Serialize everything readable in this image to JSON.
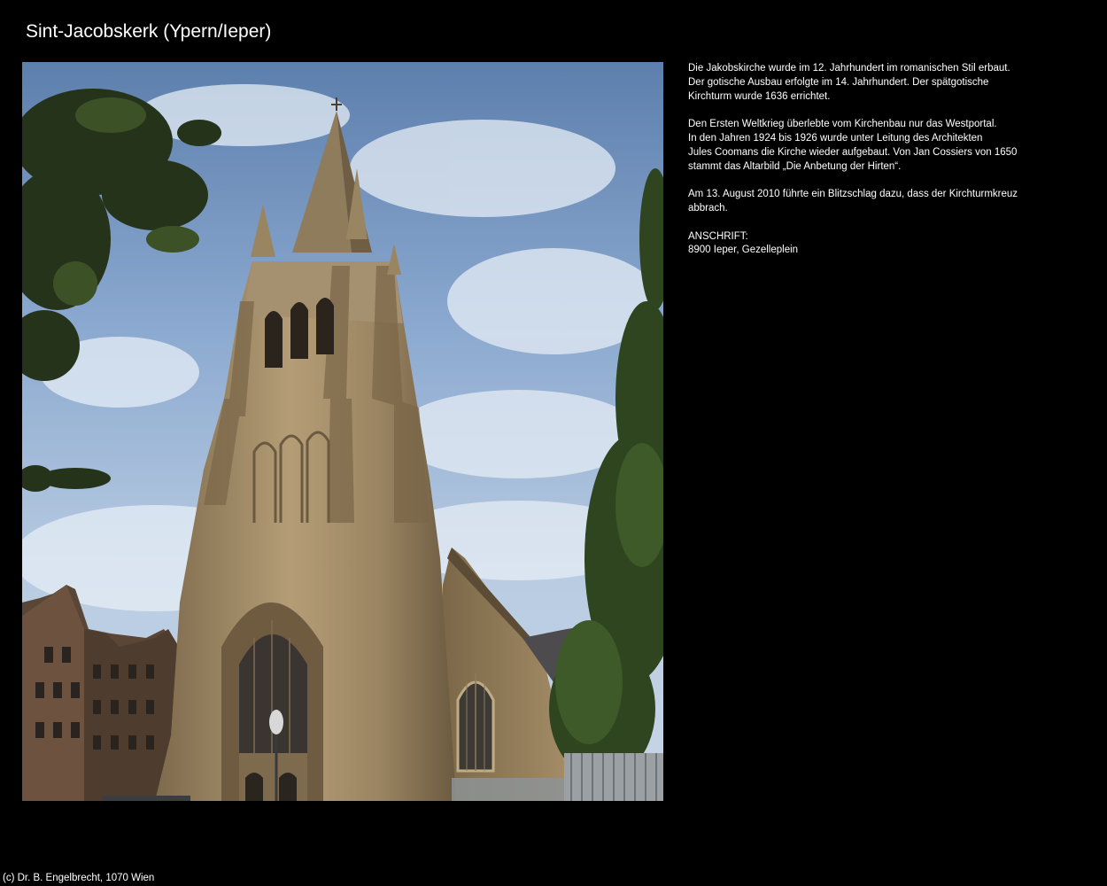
{
  "page": {
    "title": "Sint-Jacobskerk (Ypern/Ieper)"
  },
  "photo": {
    "subject": "Sint-Jacobskerk church tower"
  },
  "description": {
    "paragraphs": [
      {
        "lines": [
          "Die Jakobskirche wurde im 12. Jahrhundert im romanischen Stil erbaut.",
          "Der gotische Ausbau erfolgte im 14. Jahrhundert. Der spätgotische",
          "Kirchturm wurde 1636 errichtet."
        ]
      },
      {
        "lines": [
          "Den Ersten Weltkrieg überlebte vom Kirchenbau nur das Westportal.",
          "In den Jahren 1924 bis 1926 wurde unter Leitung des Architekten",
          "Jules Coomans die Kirche wieder aufgebaut. Von Jan Cossiers von 1650",
          "stammt das Altarbild  „Die Anbetung der Hirten“."
        ]
      },
      {
        "lines": [
          "Am 13. August 2010 führte ein Blitzschlag dazu, dass der Kirchturmkreuz",
          "abbrach."
        ]
      },
      {
        "lines": [
          "ANSCHRIFT:",
          "8900 Ieper, Gezelleplein"
        ]
      }
    ]
  },
  "footer": {
    "copyright": "(c) Dr. B. Engelbrecht, 1070 Wien"
  },
  "colors": {
    "background": "#000000",
    "text": "#ffffff",
    "sky": "#7c9cc7",
    "stone": "#9a8563",
    "foliage": "#3b4d22"
  }
}
